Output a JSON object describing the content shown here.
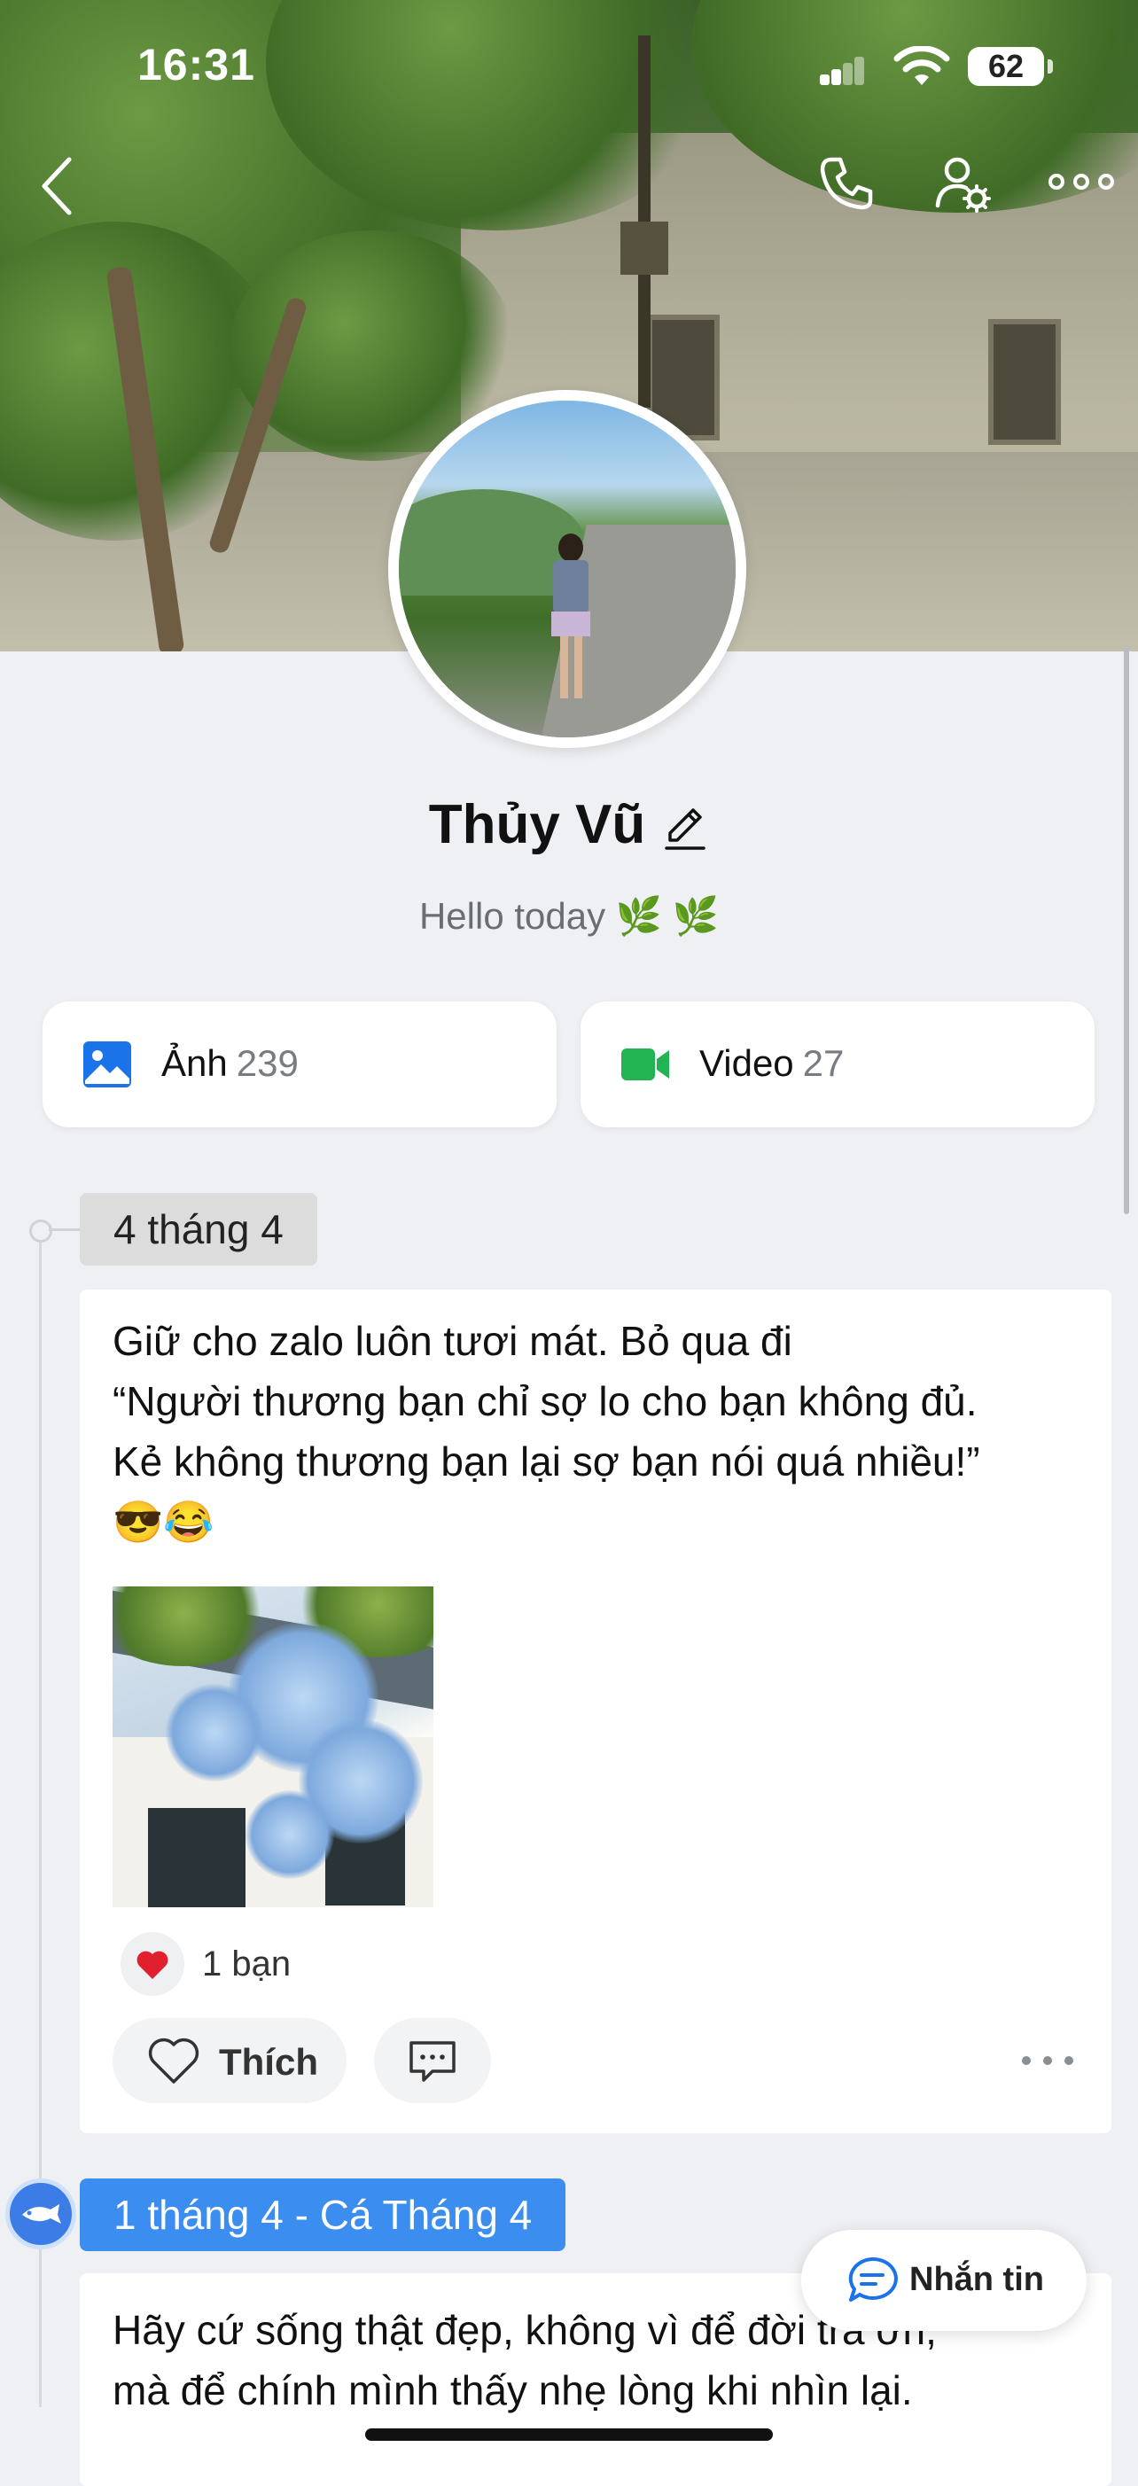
{
  "status_bar": {
    "time": "16:31",
    "battery": "62"
  },
  "nav": {
    "back_icon": "chevron-left-icon",
    "call_icon": "phone-icon",
    "settings_icon": "user-settings-icon",
    "more_icon": "more-horizontal-icon"
  },
  "profile": {
    "name": "Thủy Vũ",
    "bio": "Hello today 🌿 🌿"
  },
  "media": {
    "photos": {
      "label": "Ảnh",
      "count": "239",
      "icon": "image-icon",
      "color": "#1a73e8"
    },
    "videos": {
      "label": "Video",
      "count": "27",
      "icon": "video-camera-icon",
      "color": "#22b352"
    }
  },
  "timeline": [
    {
      "date": "4 tháng 4",
      "lines": [
        "Giữ cho zalo luôn tươi mát. Bỏ qua đi",
        "“Người thương bạn chỉ sợ lo cho bạn không đủ.",
        "Kẻ không thương bạn lại sợ  bạn nói quá nhiều!”",
        "😎😂"
      ],
      "reactions": "1 bạn",
      "like_label": "Thích"
    },
    {
      "date": "1 tháng 4 - Cá Tháng 4",
      "lines": [
        "Hãy cứ sống thật đẹp, không vì để đời trả ơn,",
        "mà để chính mình thấy nhẹ lòng khi nhìn lại."
      ]
    }
  ],
  "fab": {
    "label": "Nhắn tin",
    "icon": "chat-bubble-icon"
  },
  "colors": {
    "accent": "#3b8df0",
    "background": "#eef0f3",
    "heart": "#e0202f"
  }
}
